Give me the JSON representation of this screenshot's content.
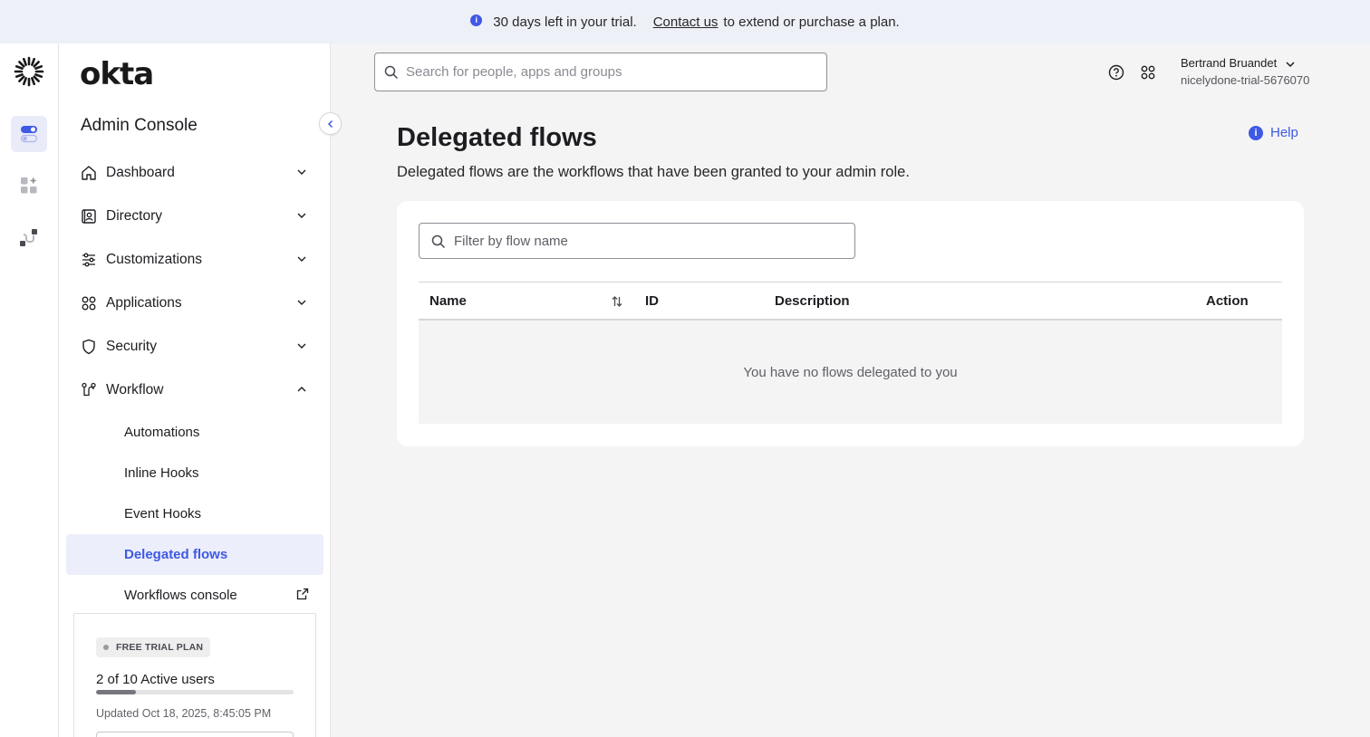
{
  "banner": {
    "trial_text": "30 days left in your trial.",
    "contact_link": "Contact us",
    "after_text": "to extend or purchase a plan."
  },
  "brand": {
    "wordmark": "okta",
    "console_title": "Admin Console",
    "accent_color": "#3f59e4"
  },
  "rail": {
    "items": [
      "admin-toggle-icon",
      "add-app-icon",
      "workflow-connector-icon"
    ]
  },
  "sidebar": {
    "items": [
      {
        "label": "Dashboard",
        "icon": "home-icon"
      },
      {
        "label": "Directory",
        "icon": "directory-icon"
      },
      {
        "label": "Customizations",
        "icon": "sliders-icon"
      },
      {
        "label": "Applications",
        "icon": "grid-icon"
      },
      {
        "label": "Security",
        "icon": "shield-icon"
      },
      {
        "label": "Workflow",
        "icon": "workflow-icon",
        "expanded": true
      }
    ],
    "workflow_sub": [
      {
        "label": "Automations"
      },
      {
        "label": "Inline Hooks"
      },
      {
        "label": "Event Hooks"
      },
      {
        "label": "Delegated flows",
        "active": true
      },
      {
        "label": "Workflows console",
        "external": true
      }
    ]
  },
  "trial_card": {
    "badge": "FREE TRIAL PLAN",
    "users_text": "2 of 10 Active users",
    "active_users": 2,
    "max_users": 10,
    "updated": "Updated Oct 18, 2025, 8:45:05 PM"
  },
  "topbar": {
    "search_placeholder": "Search for people, apps and groups",
    "user_name": "Bertrand Bruandet",
    "org": "nicelydone-trial-5676070"
  },
  "main": {
    "title": "Delegated flows",
    "description": "Delegated flows are the workflows that have been granted to your admin role.",
    "help_label": "Help",
    "filter_placeholder": "Filter by flow name",
    "columns": [
      "Name",
      "ID",
      "Description",
      "Action"
    ],
    "empty_message": "You have no flows delegated to you"
  }
}
